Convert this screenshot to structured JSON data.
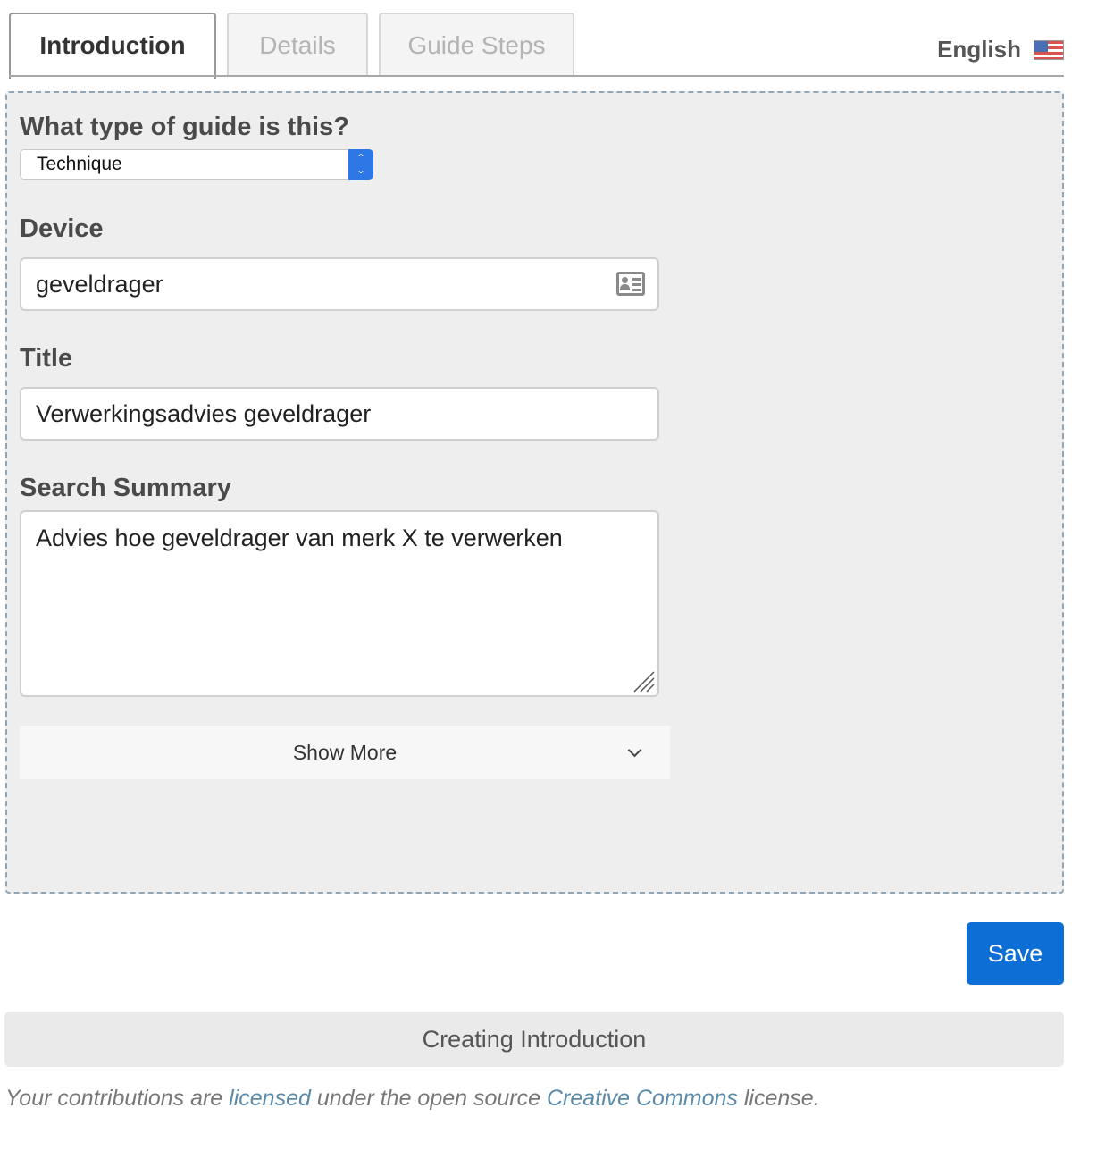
{
  "tabs": [
    {
      "label": "Introduction",
      "active": true
    },
    {
      "label": "Details",
      "active": false
    },
    {
      "label": "Guide Steps",
      "active": false
    }
  ],
  "language": {
    "label": "English",
    "flag_icon": "us-flag-icon"
  },
  "form": {
    "guide_type_label": "What type of guide is this?",
    "guide_type_value": "Technique",
    "device_label": "Device",
    "device_value": "geveldrager",
    "title_label": "Title",
    "title_value": "Verwerkingsadvies geveldrager",
    "summary_label": "Search Summary",
    "summary_value": "Advies hoe geveldrager van merk X te verwerken",
    "show_more_label": "Show More"
  },
  "actions": {
    "save_label": "Save"
  },
  "status": {
    "text": "Creating Introduction"
  },
  "footer": {
    "prefix": "Your contributions are ",
    "link1": "licensed",
    "middle": " under the open source ",
    "link2": "Creative Commons",
    "suffix": " license."
  },
  "colors": {
    "accent": "#0d6fd6",
    "select_arrow": "#2e78e6",
    "panel_bg": "#eeeeee",
    "link": "#5b8aa8"
  }
}
